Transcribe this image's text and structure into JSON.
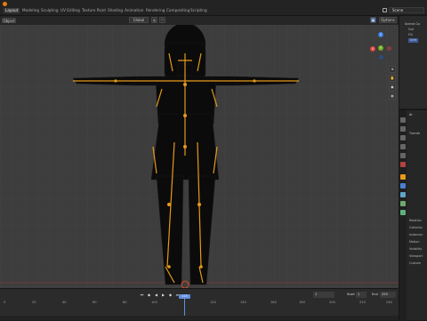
{
  "workspace_tabs": [
    "Layout",
    "Modeling",
    "Sculpting",
    "UV Editing",
    "Texture Paint",
    "Shading",
    "Animation",
    "Rendering",
    "Compositing",
    "Scripting"
  ],
  "active_tab": "Layout",
  "scene_name": "Scene",
  "viewport": {
    "object_label": "Object",
    "global_label": "Global",
    "options_label": "Options",
    "axis_x": "X",
    "axis_y": "Y",
    "axis_z": "Z"
  },
  "outliner": {
    "rows": [
      "Scene Co",
      "Col",
      "Ch",
      "Arm"
    ]
  },
  "properties": {
    "header": "Ar",
    "sections": [
      "Transfo",
      "Relation",
      "Collectio",
      "Instancin",
      "Motion",
      "Visibility",
      "Viewport",
      "Custom"
    ]
  },
  "timeline": {
    "ticks": [
      "0",
      "20",
      "40",
      "60",
      "80",
      "100",
      "120",
      "140",
      "160",
      "180",
      "200",
      "220",
      "240"
    ],
    "current_frame": "1",
    "start_label": "Start",
    "start_value": "1",
    "end_label": "End",
    "end_value": "250",
    "playhead_label": "115"
  },
  "colors": {
    "bone": "#e69a1a",
    "mesh": "#0b0b0b",
    "accent": "#5f8ee0",
    "x_axis": "#e0433f",
    "y_axis": "#6fae26",
    "z_axis": "#3b7ee6"
  }
}
